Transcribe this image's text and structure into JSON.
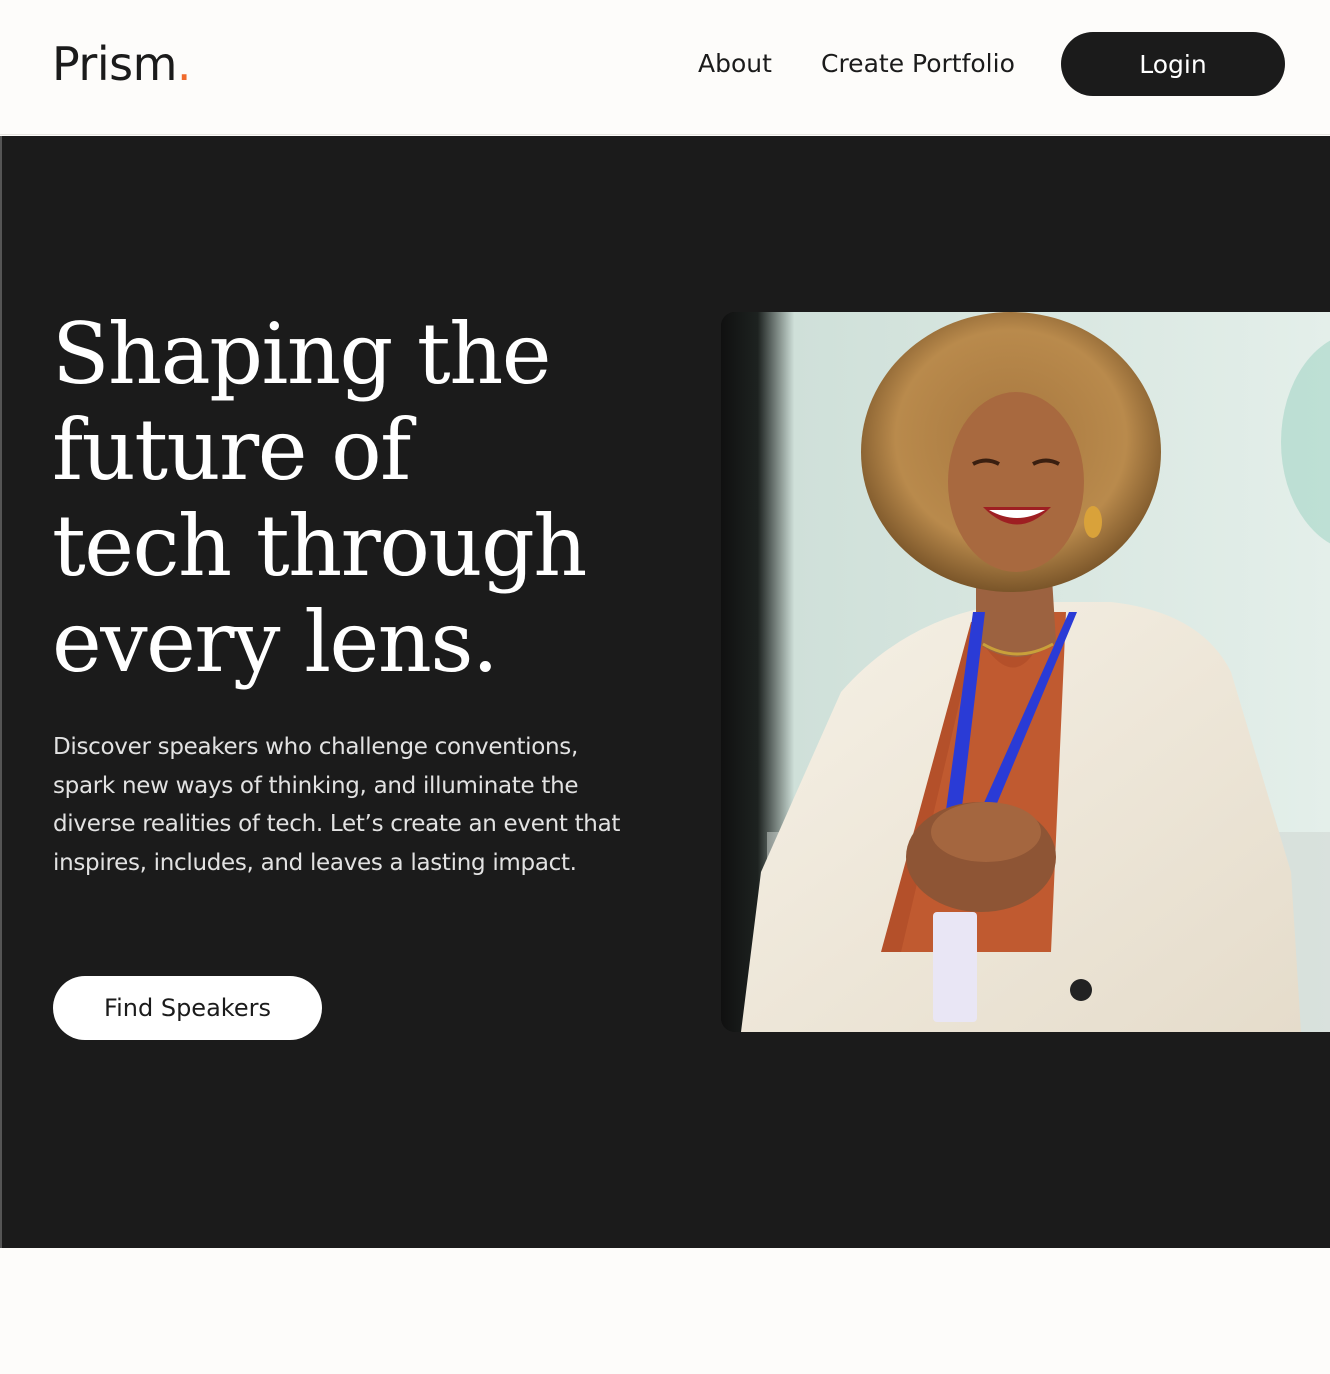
{
  "header": {
    "logo_text": "Prism",
    "logo_dot": ".",
    "nav": {
      "about": "About",
      "create_portfolio": "Create Portfolio"
    },
    "login_label": "Login"
  },
  "hero": {
    "title_lines": [
      "Shaping the",
      "future of",
      "tech through",
      "every lens."
    ],
    "description": "Discover speakers who challenge conventions, spark new ways of thinking, and illuminate the diverse realities of tech. Let’s create an event that inspires, includes, and leaves a lasting impact.",
    "cta_label": "Find Speakers",
    "image": {
      "subject": "smiling speaker with curly hair wearing white blazer and lanyard, hands clasped, on stage"
    }
  },
  "colors": {
    "accent": "#f06a2b",
    "dark": "#1b1b1b",
    "background": "#fdfcfa"
  }
}
